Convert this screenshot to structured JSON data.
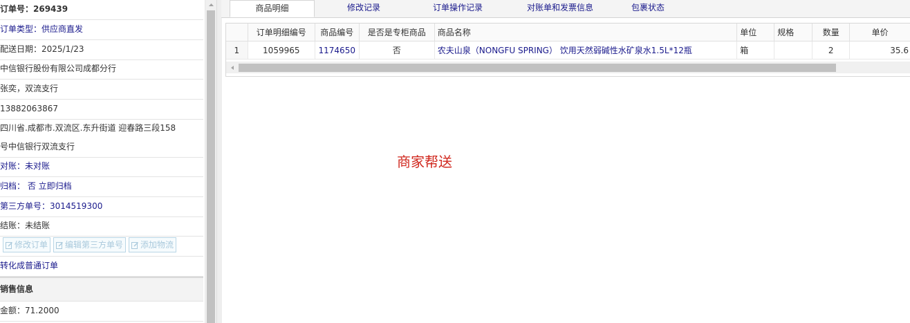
{
  "left_panel": {
    "order_no": "订单号：269439",
    "order_type": "订单类型：供应商直发",
    "delivery_date": "配送日期：2025/1/23",
    "company": "中信银行股份有限公司成都分行",
    "contact": "张奕，双流支行",
    "phone": "13882063867",
    "address_line1": "四川省.成都市.双流区.东升街道 迎春路三段158",
    "address_line2": "号中信银行双流支行",
    "reconcile": "对账：未对账",
    "archive": "归档：  否 立即归档",
    "third_party_no": "第三方单号：3014519300",
    "settlement": "结账：未结账",
    "buttons": [
      "修改订单",
      "编辑第三方单号",
      "添加物流"
    ],
    "convert_link": "转化成普通订单",
    "sales_header": "销售信息",
    "amount": "金额：71.2000"
  },
  "tabs": [
    {
      "label": "商品明细",
      "active": true
    },
    {
      "label": "修改记录",
      "active": false
    },
    {
      "label": "订单操作记录",
      "active": false
    },
    {
      "label": "对账单和发票信息",
      "active": false
    },
    {
      "label": "包裹状态",
      "active": false
    }
  ],
  "grid": {
    "columns": [
      "",
      "订单明细编号",
      "商品编号",
      "是否是专柜商品",
      "商品名称",
      "单位",
      "规格",
      "数量",
      "单价"
    ],
    "rows": [
      {
        "row_no": "1",
        "detail_no": "1059965",
        "product_no": "1174650",
        "is_counter": "否",
        "name": "农夫山泉（NONGFU SPRING） 饮用天然弱碱性水矿泉水1.5L*12瓶",
        "unit": "箱",
        "spec": "",
        "qty": "2",
        "price": "35.6"
      }
    ]
  },
  "note": "商家帮送",
  "colors": {
    "link_blue": "#1a1a8c",
    "note_red": "#d0271d",
    "disabled_button_border": "#b9d6e6"
  }
}
